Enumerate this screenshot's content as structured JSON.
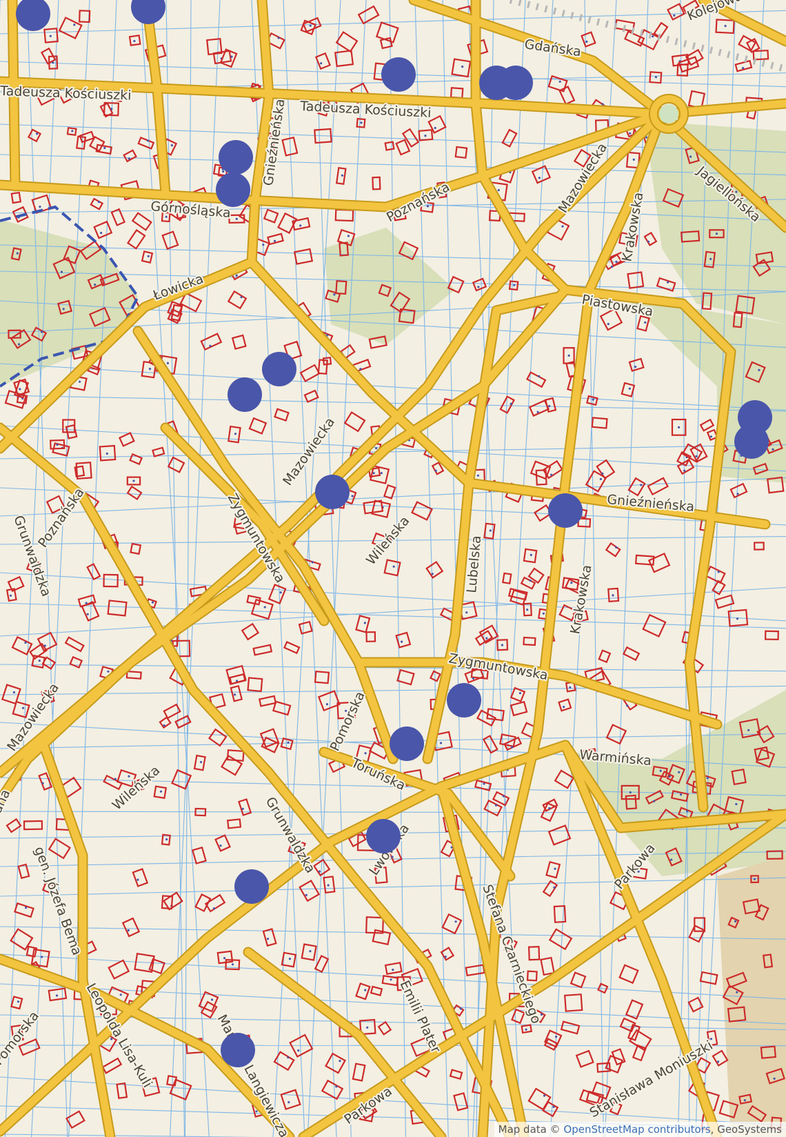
{
  "colors": {
    "background": "#f3efe2",
    "road_casing": "#c79a1a",
    "road_fill": "#f2c440",
    "parcel_line": "#7fb6e6",
    "building_outline": "#cc2a2a",
    "green_area": "#d8dfb9",
    "marker": "#4a56aa",
    "boundary": "#3a56b0"
  },
  "marker_icon": "filled-circle-marker",
  "streets": [
    {
      "name": "Tadeusza Kościuszki"
    },
    {
      "name": "Tadeusza Kościuszki"
    },
    {
      "name": "Gdańska"
    },
    {
      "name": "Kolejowa"
    },
    {
      "name": "Górnośląska"
    },
    {
      "name": "Gnieźnieńska"
    },
    {
      "name": "Poznańska"
    },
    {
      "name": "Mazowiecka"
    },
    {
      "name": "Krakowska"
    },
    {
      "name": "Jagiellońska"
    },
    {
      "name": "Łowicka"
    },
    {
      "name": "Piastowska"
    },
    {
      "name": "Mazowiecka"
    },
    {
      "name": "Gnieźnieńska"
    },
    {
      "name": "Poznańska"
    },
    {
      "name": "Grunwaldzka"
    },
    {
      "name": "Zygmuntowska"
    },
    {
      "name": "Wileńska"
    },
    {
      "name": "Lubelska"
    },
    {
      "name": "Krakowska"
    },
    {
      "name": "Zygmuntowska"
    },
    {
      "name": "Mazowiecka"
    },
    {
      "name": "Pomorska"
    },
    {
      "name": "Warmińska"
    },
    {
      "name": "Toruńska"
    },
    {
      "name": "Wileńska"
    },
    {
      "name": "Grunwaldzka"
    },
    {
      "name": "Lwowska"
    },
    {
      "name": "Parkowa"
    },
    {
      "name": "gen. Józefa Bema"
    },
    {
      "name": "Stefana Czarnieckiego"
    },
    {
      "name": "Pomorska"
    },
    {
      "name": "Leopolda Lisa-Kuli"
    },
    {
      "name": "Emilii Plater"
    },
    {
      "name": "Mariana Langiewicza"
    },
    {
      "name": "Parkowa"
    },
    {
      "name": "Stanisława Moniuszki"
    },
    {
      "name": "ana"
    }
  ],
  "markers": [
    {
      "id": 1
    },
    {
      "id": 2
    },
    {
      "id": 3
    },
    {
      "id": 4
    },
    {
      "id": 5
    },
    {
      "id": 6
    },
    {
      "id": 7
    },
    {
      "id": 8
    },
    {
      "id": 9
    },
    {
      "id": 10
    },
    {
      "id": 11
    },
    {
      "id": 12
    },
    {
      "id": 13
    },
    {
      "id": 14
    },
    {
      "id": 15
    },
    {
      "id": 16
    },
    {
      "id": 17
    },
    {
      "id": 18
    },
    {
      "id": 19
    },
    {
      "id": 20
    }
  ],
  "attribution": {
    "prefix": "Map data ©",
    "link": "OpenStreetMap contributors",
    "suffix": ", GeoSystems"
  }
}
